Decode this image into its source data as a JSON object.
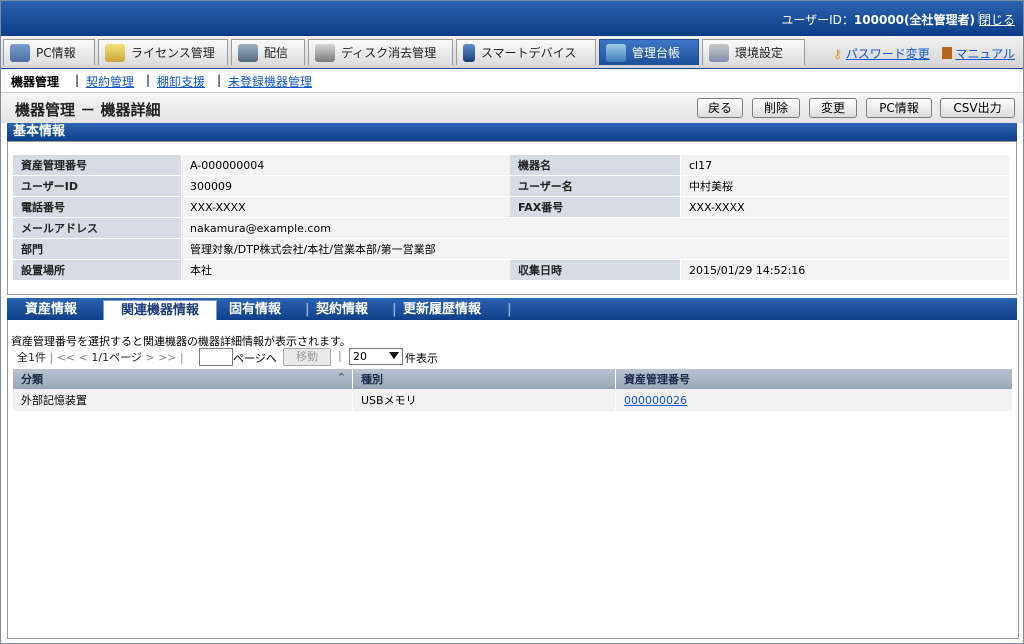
{
  "topbar": {
    "user_label": "ユーザーID：",
    "user_value": "100000(全社管理者)",
    "close": "閉じる"
  },
  "navtabs": [
    {
      "label": "PC情報",
      "icon": "pc-icon"
    },
    {
      "label": "ライセンス管理",
      "icon": "license-icon"
    },
    {
      "label": "配信",
      "icon": "delivery-icon"
    },
    {
      "label": "ディスク消去管理",
      "icon": "disk-erase-icon"
    },
    {
      "label": "スマートデバイス",
      "icon": "smartphone-icon"
    },
    {
      "label": "管理台帳",
      "icon": "ledger-icon"
    },
    {
      "label": "環境設定",
      "icon": "tools-icon"
    }
  ],
  "toplinks": {
    "password": "パスワード変更",
    "manual": "マニュアル"
  },
  "subnav": {
    "current": "機器管理",
    "items": [
      "契約管理",
      "棚卸支援",
      "未登録機器管理"
    ]
  },
  "page": {
    "title": "機器管理 － 機器詳細"
  },
  "buttons": {
    "back": "戻る",
    "delete": "削除",
    "change": "変更",
    "pcinfo": "PC情報",
    "csv": "CSV出力"
  },
  "basic": {
    "title": "基本情報",
    "rows": [
      {
        "l1": "資産管理番号",
        "v1": "A-000000004",
        "l2": "機器名",
        "v2": "cl17"
      },
      {
        "l1": "ユーザーID",
        "v1": "300009",
        "l2": "ユーザー名",
        "v2": "中村美桜"
      },
      {
        "l1": "電話番号",
        "v1": "XXX-XXXX",
        "l2": "FAX番号",
        "v2": "XXX-XXXX"
      },
      {
        "l1": "メールアドレス",
        "v1": "nakamura@example.com"
      },
      {
        "l1": "部門",
        "v1": "管理対象/DTP株式会社/本社/営業本部/第一営業部"
      },
      {
        "l1": "設置場所",
        "v1": "本社",
        "l2": "収集日時",
        "v2": "2015/01/29 14:52:16"
      }
    ]
  },
  "detail_tabs": [
    "資産情報",
    "関連機器情報",
    "固有情報",
    "契約情報",
    "更新履歴情報"
  ],
  "related": {
    "note": "資産管理番号を選択すると関連機器の機器詳細情報が表示されます。",
    "total": "全1件",
    "page_info": "1/1ページ",
    "page_suffix": "ページへ",
    "move": "移動",
    "per_page": "20",
    "per_page_suffix": "件表示",
    "columns": [
      "分類",
      "種別",
      "資産管理番号"
    ],
    "rows": [
      {
        "category": "外部記憶装置",
        "type": "USBメモリ",
        "asset_no": "000000026"
      }
    ]
  },
  "colors": {
    "header_blue": "#0c3d86",
    "link": "#1155cc",
    "label_bg": "#d6dbe4"
  }
}
